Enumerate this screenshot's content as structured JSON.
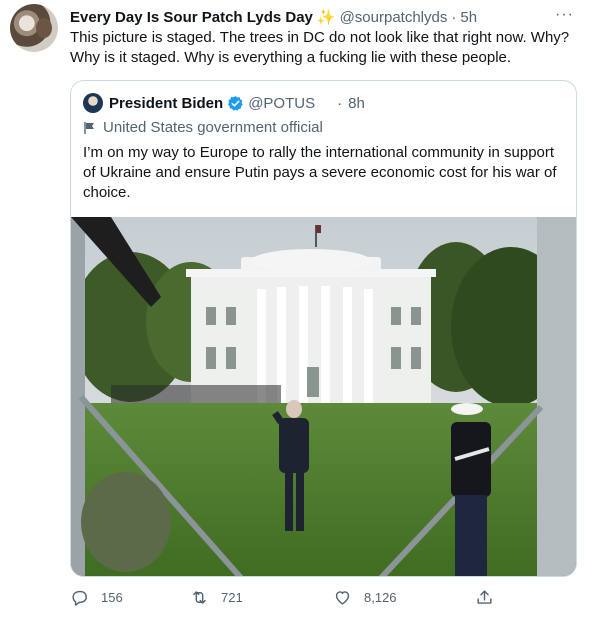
{
  "tweet": {
    "author_name": "Every Day Is Sour Patch Lyds Day",
    "author_emoji": "✨",
    "author_handle": "@sourpatchlyds",
    "separator": "·",
    "time": "5h",
    "more": "···",
    "text_line1": "This picture is staged. The trees in DC do not look like that right now. Why?",
    "text_line2": "Why is it staged. Why is everything a fucking lie with these people."
  },
  "quoted": {
    "author_name": "President Biden",
    "author_handle": "@POTUS",
    "separator": "·",
    "time": "8h",
    "label": "United States government official",
    "text_line1": "I’m on my way to Europe to rally the international community in support",
    "text_line2": "of Ukraine and ensure Putin pays a severe economic cost for his war of",
    "text_line3": "choice."
  },
  "actions": {
    "replies": "156",
    "retweets": "721",
    "likes": "8,126"
  },
  "colors": {
    "text": "#0f1419",
    "secondary": "#536471",
    "verified": "#1d9bf0",
    "border": "#cfd9de"
  }
}
